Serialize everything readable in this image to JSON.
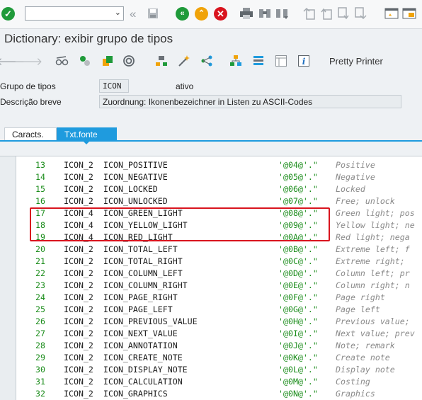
{
  "toolbar": {
    "command_field_value": "",
    "icons": [
      "enter-icon",
      "back-icon",
      "save-icon",
      "go-back-icon",
      "exit-icon",
      "cancel-icon",
      "print-icon",
      "find-icon",
      "find-next-icon",
      "first-page-icon",
      "previous-page-icon",
      "next-page-icon",
      "last-page-icon",
      "new-session-icon",
      "shortcut-icon"
    ]
  },
  "window": {
    "title": "Dictionary: exibir grupo de tipos"
  },
  "app_toolbar": {
    "pretty_printer_label": "Pretty Printer"
  },
  "header": {
    "type_group_label": "Grupo de tipos",
    "type_group_value": "ICON",
    "status": "ativo",
    "short_desc_label": "Descrição breve",
    "short_desc_value": "Zuordnung: Ikonenbezeichner in Listen zu ASCII-Codes"
  },
  "tabs": [
    {
      "label": "Caracts.",
      "active": false
    },
    {
      "label": "Txt.fonte",
      "active": true
    }
  ],
  "source_lines": [
    {
      "num": "13",
      "kw": "ICON_2",
      "name": "ICON_POSITIVE",
      "val": "'@04@'.\"",
      "comment": "Positive"
    },
    {
      "num": "14",
      "kw": "ICON_2",
      "name": "ICON_NEGATIVE",
      "val": "'@05@'.\"",
      "comment": "Negative"
    },
    {
      "num": "15",
      "kw": "ICON_2",
      "name": "ICON_LOCKED",
      "val": "'@06@'.\"",
      "comment": "Locked"
    },
    {
      "num": "16",
      "kw": "ICON_2",
      "name": "ICON_UNLOCKED",
      "val": "'@07@'.\"",
      "comment": "Free; unlock"
    },
    {
      "num": "17",
      "kw": "ICON_4",
      "name": "ICON_GREEN_LIGHT",
      "val": "'@08@'.\"",
      "comment": "Green light; pos"
    },
    {
      "num": "18",
      "kw": "ICON_4",
      "name": "ICON_YELLOW_LIGHT",
      "val": "'@09@'.\"",
      "comment": "Yellow light; ne"
    },
    {
      "num": "19",
      "kw": "ICON_4",
      "name": "ICON_RED_LIGHT",
      "val": "'@0A@'.\"",
      "comment": "Red light; nega"
    },
    {
      "num": "20",
      "kw": "ICON_2",
      "name": "ICON_TOTAL_LEFT",
      "val": "'@0B@'.\"",
      "comment": "Extreme left; f"
    },
    {
      "num": "21",
      "kw": "ICON_2",
      "name": "ICON_TOTAL_RIGHT",
      "val": "'@0C@'.\"",
      "comment": "Extreme right; "
    },
    {
      "num": "22",
      "kw": "ICON_2",
      "name": "ICON_COLUMN_LEFT",
      "val": "'@0D@'.\"",
      "comment": "Column left; pr"
    },
    {
      "num": "23",
      "kw": "ICON_2",
      "name": "ICON_COLUMN_RIGHT",
      "val": "'@0E@'.\"",
      "comment": "Column right; n"
    },
    {
      "num": "24",
      "kw": "ICON_2",
      "name": "ICON_PAGE_RIGHT",
      "val": "'@0F@'.\"",
      "comment": "Page right"
    },
    {
      "num": "25",
      "kw": "ICON_2",
      "name": "ICON_PAGE_LEFT",
      "val": "'@0G@'.\"",
      "comment": "Page left"
    },
    {
      "num": "26",
      "kw": "ICON_2",
      "name": "ICON_PREVIOUS_VALUE",
      "val": "'@0H@'.\"",
      "comment": "Previous value;"
    },
    {
      "num": "27",
      "kw": "ICON_2",
      "name": "ICON_NEXT_VALUE",
      "val": "'@0I@'.\"",
      "comment": "Next value; prev"
    },
    {
      "num": "28",
      "kw": "ICON_2",
      "name": "ICON_ANNOTATION",
      "val": "'@0J@'.\"",
      "comment": "Note; remark"
    },
    {
      "num": "29",
      "kw": "ICON_2",
      "name": "ICON_CREATE_NOTE",
      "val": "'@0K@'.\"",
      "comment": "Create note"
    },
    {
      "num": "30",
      "kw": "ICON_2",
      "name": "ICON_DISPLAY_NOTE",
      "val": "'@0L@'.\"",
      "comment": "Display note"
    },
    {
      "num": "31",
      "kw": "ICON_2",
      "name": "ICON_CALCULATION",
      "val": "'@0M@'.\"",
      "comment": "Costing"
    },
    {
      "num": "32",
      "kw": "ICON_2",
      "name": "ICON_GRAPHICS",
      "val": "'@0N@'.\"",
      "comment": "Graphics"
    }
  ],
  "colors": {
    "accent": "#1f9bde",
    "highlight_border": "#d9141e",
    "line_number": "#1a8c1a",
    "comment": "#8a8a8a"
  }
}
